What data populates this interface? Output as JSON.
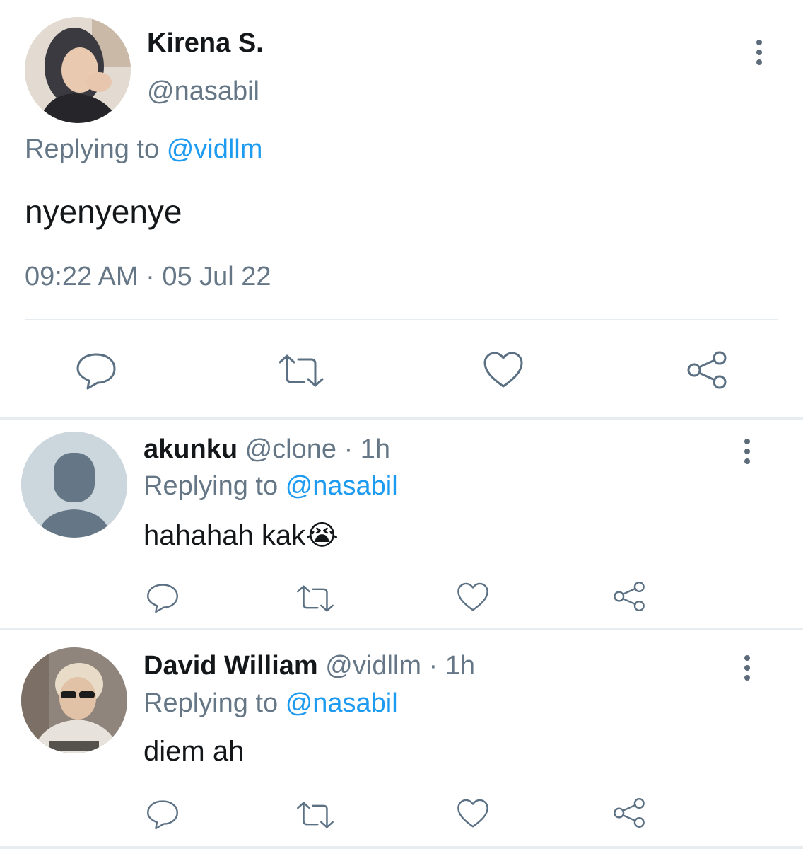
{
  "main_tweet": {
    "display_name": "Kirena S.",
    "handle": "@nasabil",
    "replying_prefix": "Replying to",
    "replying_handle": "@vidllm",
    "text": "nyenyenye",
    "timestamp": "09:22 AM · 05 Jul 22"
  },
  "replies": [
    {
      "display_name": "akunku",
      "handle_time": "@clone · 1h",
      "replying_prefix": "Replying to",
      "replying_handle": "@nasabil",
      "text": "hahahah kak",
      "emoji": "😭"
    },
    {
      "display_name": "David William",
      "handle_time": "@vidllm · 1h",
      "replying_prefix": "Replying to",
      "replying_handle": "@nasabil",
      "text": "diem ah"
    }
  ],
  "colors": {
    "link": "#1d9bf0",
    "secondary_text": "#657786",
    "icon": "#5b7083",
    "divider": "#e6ecf0"
  },
  "icons": [
    "more-vertical-icon",
    "reply-icon",
    "retweet-icon",
    "like-icon",
    "share-icon"
  ]
}
